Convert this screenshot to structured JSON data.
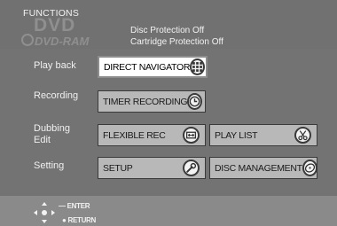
{
  "header": {
    "title": "FUNCTIONS",
    "logo_top": "DVD",
    "logo_bottom": "DVD-RAM",
    "disc_protection": "Disc Protection  Off",
    "cartridge_protection": "Cartridge Protection  Off"
  },
  "labels": {
    "play_back": "Play back",
    "recording": "Recording",
    "dubbing": "Dubbing",
    "edit": "Edit",
    "setting": "Setting"
  },
  "menu": {
    "direct_navigator": {
      "label": "DIRECT NAVIGATOR",
      "icon": "grid-icon"
    },
    "timer_recording": {
      "label": "TIMER RECORDING",
      "icon": "clock-icon"
    },
    "flexible_rec": {
      "label": "FLEXIBLE REC",
      "icon": "flexible-rec-icon"
    },
    "play_list": {
      "label": "PLAY LIST",
      "icon": "scissors-icon"
    },
    "setup": {
      "label": "SETUP",
      "icon": "wrench-icon"
    },
    "disc_management": {
      "label": "DISC MANAGEMENT",
      "icon": "disc-icon"
    }
  },
  "footer": {
    "enter": "ENTER",
    "return": "RETURN"
  },
  "colors": {
    "background": "#737373",
    "button": "#b8b8b8",
    "selected_button": "#ffffff",
    "text": "#f2f2f2"
  }
}
